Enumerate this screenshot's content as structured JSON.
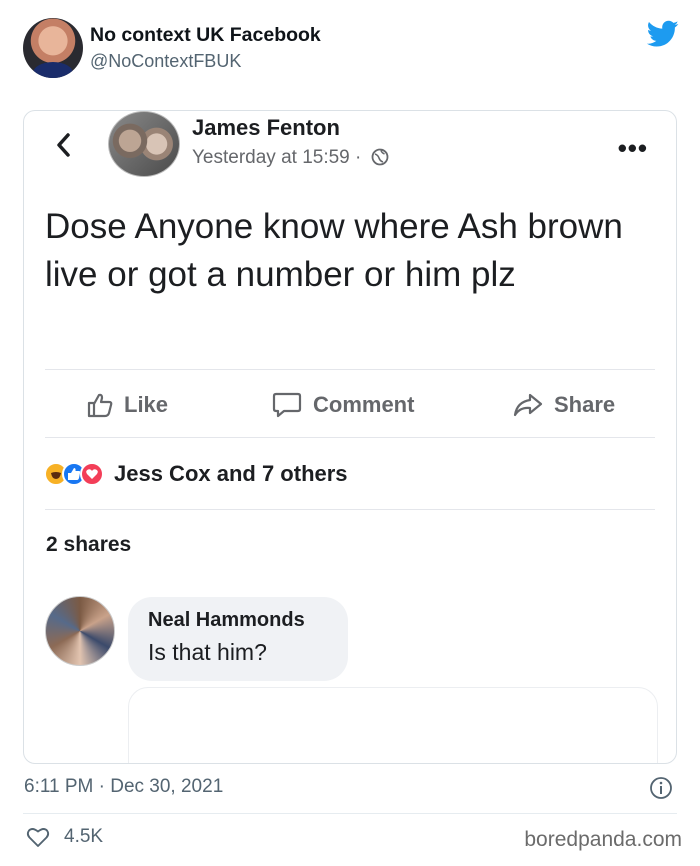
{
  "tweet": {
    "display_name": "No context UK Facebook",
    "handle": "@NoContextFBUK",
    "timestamp": "6:11 PM · Dec 30, 2021",
    "likes": "4.5K"
  },
  "fb_post": {
    "author": "James Fenton",
    "time": "Yesterday at 15:59 ·",
    "text": "Dose Anyone know where Ash brown live or got a number or him plz",
    "actions": {
      "like": "Like",
      "comment": "Comment",
      "share": "Share"
    },
    "reactions_text": "Jess Cox and 7 others",
    "shares": "2 shares",
    "comment": {
      "author": "Neal Hammonds",
      "text": "Is that him?"
    }
  },
  "watermark": "boredpanda.com",
  "colors": {
    "twitter_blue": "#1d9bf0",
    "fb_grey": "#65676b",
    "like_blue": "#1877f2",
    "love_red": "#f33e58",
    "haha_yellow": "#f7b125"
  },
  "icons": [
    "twitter-bird-icon",
    "back-chevron-icon",
    "globe-icon",
    "more-dots-icon",
    "thumbs-up-icon",
    "comment-bubble-icon",
    "share-arrow-icon",
    "info-icon",
    "heart-icon"
  ]
}
